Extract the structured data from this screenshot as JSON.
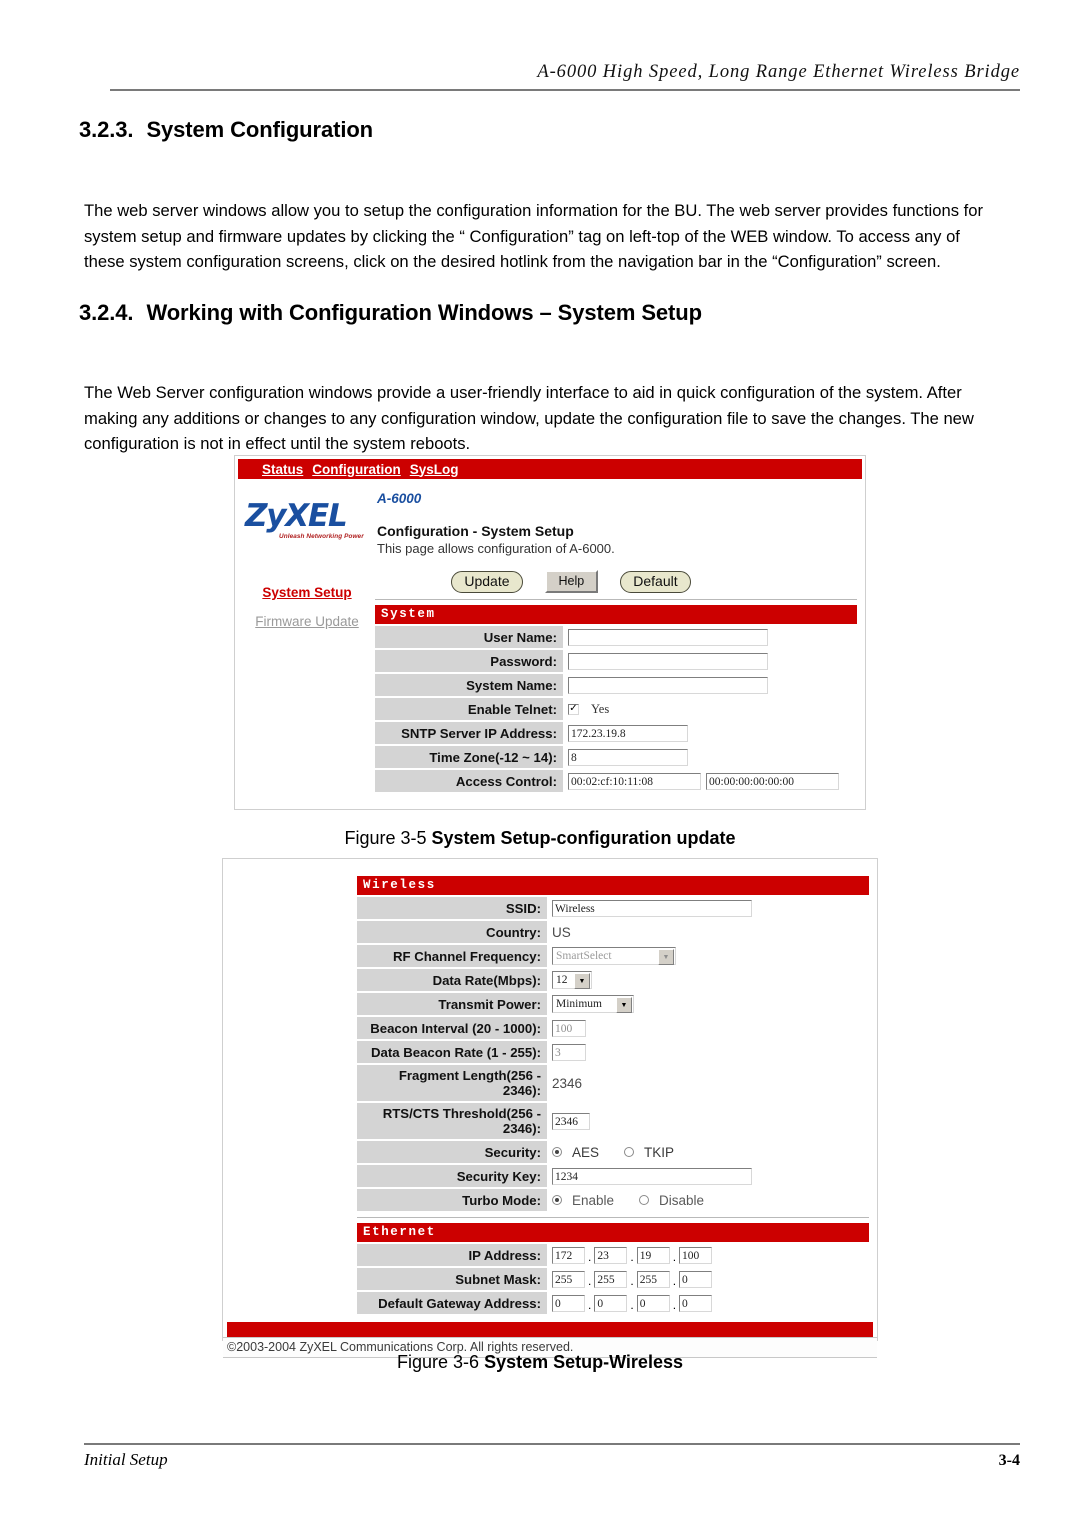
{
  "header": {
    "running_title": "A-6000 High Speed, Long Range Ethernet Wireless Bridge"
  },
  "sections": {
    "s323_num": "3.2.3.",
    "s323_title": "System Configuration",
    "s323_para": "The web server windows allow you to setup the configuration information for the BU. The web server provides functions for system setup and firmware updates by clicking the “ Configuration” tag on left-top of the WEB window. To access any of these system configuration screens, click on the desired hotlink from the navigation bar in the “Configuration” screen.",
    "s324_num": "3.2.4.",
    "s324_title": "Working with Configuration Windows – System Setup",
    "s324_para": "The Web Server configuration windows provide a user-friendly interface to aid in quick configuration of the system. After making any additions or changes to any configuration window, update the configuration file to save the changes. The new configuration is not in effect until the system reboots."
  },
  "figure35": {
    "caption_lead": "Figure 3-5",
    "caption_bold": "System Setup-configuration update",
    "nav": [
      {
        "label": "Status"
      },
      {
        "label": "Configuration"
      },
      {
        "label": "SysLog"
      }
    ],
    "logo": {
      "text": "ZyXEL",
      "tagline": "Unleash Networking Power"
    },
    "device_name": "A-6000",
    "page_title": "Configuration - System Setup",
    "page_subtitle": "This page allows configuration of A-6000.",
    "buttons": {
      "update": "Update",
      "help": "Help",
      "default": "Default"
    },
    "sidebar": [
      {
        "label": "System Setup",
        "state": "active"
      },
      {
        "label": "Firmware Update",
        "state": "muted"
      }
    ],
    "system_section": {
      "title": "System",
      "fields": [
        {
          "label": "User Name:",
          "value": "",
          "type": "text"
        },
        {
          "label": "Password:",
          "value": "",
          "type": "text"
        },
        {
          "label": "System Name:",
          "value": "",
          "type": "text"
        },
        {
          "label": "Enable Telnet:",
          "value": "Yes",
          "type": "checkbox",
          "checked": true
        },
        {
          "label": "SNTP Server IP Address:",
          "value": "172.23.19.8",
          "type": "text"
        },
        {
          "label": "Time Zone(-12 ~ 14):",
          "value": "8",
          "type": "text"
        },
        {
          "label": "Access Control:",
          "value": "00:02:cf:10:11:08",
          "value2": "00:00:00:00:00:00",
          "type": "text-pair"
        }
      ]
    }
  },
  "figure36": {
    "caption_lead": "Figure 3-6",
    "caption_bold": "System Setup-Wireless",
    "wireless_section": {
      "title": "Wireless",
      "fields": [
        {
          "label": "SSID:",
          "value": "Wireless",
          "type": "text"
        },
        {
          "label": "Country:",
          "value": "US",
          "type": "plain"
        },
        {
          "label": "RF Channel Frequency:",
          "value": "SmartSelect",
          "type": "select-wide"
        },
        {
          "label": "Data Rate(Mbps):",
          "value": "12",
          "type": "select-small"
        },
        {
          "label": "Transmit Power:",
          "value": "Minimum",
          "type": "select-med"
        },
        {
          "label": "Beacon Interval (20 - 1000):",
          "value": "100",
          "type": "text-small-dim"
        },
        {
          "label": "Data Beacon Rate (1 - 255):",
          "value": "3",
          "type": "text-small-dim"
        },
        {
          "label": "Fragment Length(256 - 2346):",
          "value": "2346",
          "type": "plain"
        },
        {
          "label": "RTS/CTS Threshold(256 - 2346):",
          "value": "2346",
          "type": "text-small"
        },
        {
          "label": "Security:",
          "type": "radio",
          "options": [
            {
              "label": "AES",
              "selected": true
            },
            {
              "label": "TKIP",
              "selected": false
            }
          ]
        },
        {
          "label": "Security Key:",
          "value": "1234",
          "type": "text"
        },
        {
          "label": "Turbo Mode:",
          "type": "radio",
          "options": [
            {
              "label": "Enable",
              "selected": true
            },
            {
              "label": "Disable",
              "selected": false
            }
          ]
        }
      ]
    },
    "ethernet_section": {
      "title": "Ethernet",
      "fields": [
        {
          "label": "IP Address:",
          "octets": [
            "172",
            "23",
            "19",
            "100"
          ]
        },
        {
          "label": "Subnet Mask:",
          "octets": [
            "255",
            "255",
            "255",
            "0"
          ]
        },
        {
          "label": "Default Gateway Address:",
          "octets": [
            "0",
            "0",
            "0",
            "0"
          ]
        }
      ]
    },
    "copyright": "©2003-2004 ZyXEL Communications Corp.  All rights reserved."
  },
  "footer": {
    "left": "Initial Setup",
    "page": "3-4"
  },
  "colors": {
    "brand_red": "#cc0000",
    "logo_blue": "#1a4fa0",
    "tagline_red": "#b02020",
    "label_gray": "#d4d4d4"
  }
}
